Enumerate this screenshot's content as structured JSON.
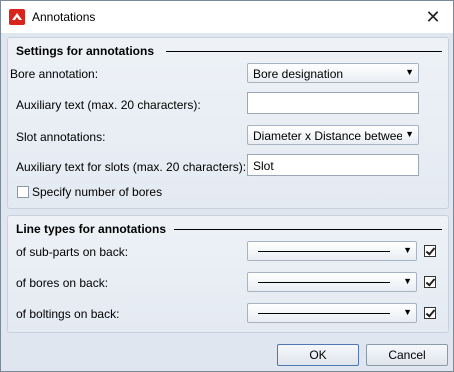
{
  "window": {
    "title": "Annotations",
    "close_glyph": "✕"
  },
  "settings": {
    "group_title": "Settings for annotations",
    "bore_annotation_label": "Bore annotation:",
    "bore_annotation_value": "Bore designation",
    "aux_text_label": "Auxiliary text (max. 20 characters):",
    "aux_text_value": "",
    "slot_annotations_label": "Slot annotations:",
    "slot_annotations_value": "Diameter x Distance between",
    "aux_slots_label": "Auxiliary text for slots (max. 20 characters):",
    "aux_slots_value": "Slot",
    "specify_bores_label": "Specify number of bores",
    "specify_bores_checked": false
  },
  "line_types": {
    "group_title": "Line types for annotations",
    "rows": [
      {
        "label": "of sub-parts on back:",
        "checked": true
      },
      {
        "label": "of bores on back:",
        "checked": true
      },
      {
        "label": "of boltings on back:",
        "checked": true
      }
    ]
  },
  "buttons": {
    "ok": "OK",
    "cancel": "Cancel"
  },
  "icons": {
    "app": "app-logo-icon",
    "dropdown": "chevron-down-icon"
  },
  "colors": {
    "client_bg": "#dfe6ef",
    "logo_red": "#d9241c"
  }
}
